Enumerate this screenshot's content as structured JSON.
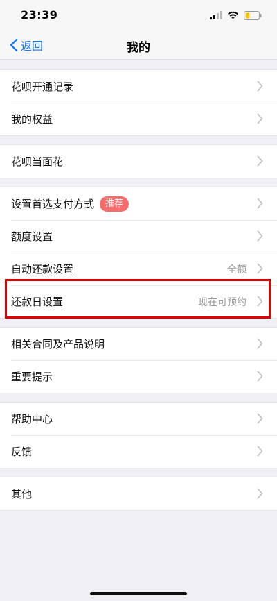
{
  "status_bar": {
    "time": "23:39"
  },
  "nav": {
    "back_label": "返回",
    "title": "我的"
  },
  "groups": [
    {
      "items": [
        {
          "label": "花呗开通记录"
        },
        {
          "label": "我的权益"
        }
      ]
    },
    {
      "items": [
        {
          "label": "花呗当面花"
        }
      ]
    },
    {
      "items": [
        {
          "label": "设置首选支付方式",
          "badge": "推荐"
        },
        {
          "label": "额度设置"
        },
        {
          "label": "自动还款设置",
          "value": "全额"
        },
        {
          "label": "还款日设置",
          "value": "现在可预约"
        }
      ]
    },
    {
      "items": [
        {
          "label": "相关合同及产品说明"
        },
        {
          "label": "重要提示"
        }
      ]
    },
    {
      "items": [
        {
          "label": "帮助中心"
        },
        {
          "label": "反馈"
        }
      ]
    },
    {
      "items": [
        {
          "label": "其他"
        }
      ]
    }
  ],
  "colors": {
    "accent": "#1677ff",
    "badge": "#f66b6b",
    "highlight": "#e00000",
    "background": "#efeff4"
  }
}
